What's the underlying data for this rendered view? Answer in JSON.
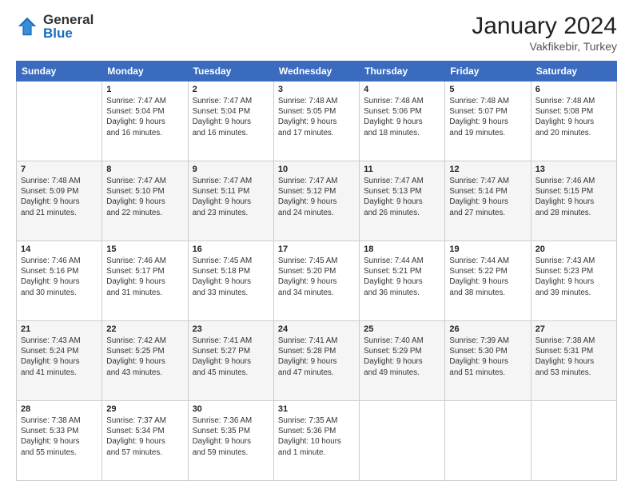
{
  "header": {
    "logo_general": "General",
    "logo_blue": "Blue",
    "cal_title": "January 2024",
    "cal_subtitle": "Vakfikebir, Turkey"
  },
  "days_of_week": [
    "Sunday",
    "Monday",
    "Tuesday",
    "Wednesday",
    "Thursday",
    "Friday",
    "Saturday"
  ],
  "weeks": [
    [
      {
        "num": "",
        "info": ""
      },
      {
        "num": "1",
        "info": "Sunrise: 7:47 AM\nSunset: 5:04 PM\nDaylight: 9 hours\nand 16 minutes."
      },
      {
        "num": "2",
        "info": "Sunrise: 7:47 AM\nSunset: 5:04 PM\nDaylight: 9 hours\nand 16 minutes."
      },
      {
        "num": "3",
        "info": "Sunrise: 7:48 AM\nSunset: 5:05 PM\nDaylight: 9 hours\nand 17 minutes."
      },
      {
        "num": "4",
        "info": "Sunrise: 7:48 AM\nSunset: 5:06 PM\nDaylight: 9 hours\nand 18 minutes."
      },
      {
        "num": "5",
        "info": "Sunrise: 7:48 AM\nSunset: 5:07 PM\nDaylight: 9 hours\nand 19 minutes."
      },
      {
        "num": "6",
        "info": "Sunrise: 7:48 AM\nSunset: 5:08 PM\nDaylight: 9 hours\nand 20 minutes."
      }
    ],
    [
      {
        "num": "7",
        "info": "Sunrise: 7:48 AM\nSunset: 5:09 PM\nDaylight: 9 hours\nand 21 minutes."
      },
      {
        "num": "8",
        "info": "Sunrise: 7:47 AM\nSunset: 5:10 PM\nDaylight: 9 hours\nand 22 minutes."
      },
      {
        "num": "9",
        "info": "Sunrise: 7:47 AM\nSunset: 5:11 PM\nDaylight: 9 hours\nand 23 minutes."
      },
      {
        "num": "10",
        "info": "Sunrise: 7:47 AM\nSunset: 5:12 PM\nDaylight: 9 hours\nand 24 minutes."
      },
      {
        "num": "11",
        "info": "Sunrise: 7:47 AM\nSunset: 5:13 PM\nDaylight: 9 hours\nand 26 minutes."
      },
      {
        "num": "12",
        "info": "Sunrise: 7:47 AM\nSunset: 5:14 PM\nDaylight: 9 hours\nand 27 minutes."
      },
      {
        "num": "13",
        "info": "Sunrise: 7:46 AM\nSunset: 5:15 PM\nDaylight: 9 hours\nand 28 minutes."
      }
    ],
    [
      {
        "num": "14",
        "info": "Sunrise: 7:46 AM\nSunset: 5:16 PM\nDaylight: 9 hours\nand 30 minutes."
      },
      {
        "num": "15",
        "info": "Sunrise: 7:46 AM\nSunset: 5:17 PM\nDaylight: 9 hours\nand 31 minutes."
      },
      {
        "num": "16",
        "info": "Sunrise: 7:45 AM\nSunset: 5:18 PM\nDaylight: 9 hours\nand 33 minutes."
      },
      {
        "num": "17",
        "info": "Sunrise: 7:45 AM\nSunset: 5:20 PM\nDaylight: 9 hours\nand 34 minutes."
      },
      {
        "num": "18",
        "info": "Sunrise: 7:44 AM\nSunset: 5:21 PM\nDaylight: 9 hours\nand 36 minutes."
      },
      {
        "num": "19",
        "info": "Sunrise: 7:44 AM\nSunset: 5:22 PM\nDaylight: 9 hours\nand 38 minutes."
      },
      {
        "num": "20",
        "info": "Sunrise: 7:43 AM\nSunset: 5:23 PM\nDaylight: 9 hours\nand 39 minutes."
      }
    ],
    [
      {
        "num": "21",
        "info": "Sunrise: 7:43 AM\nSunset: 5:24 PM\nDaylight: 9 hours\nand 41 minutes."
      },
      {
        "num": "22",
        "info": "Sunrise: 7:42 AM\nSunset: 5:25 PM\nDaylight: 9 hours\nand 43 minutes."
      },
      {
        "num": "23",
        "info": "Sunrise: 7:41 AM\nSunset: 5:27 PM\nDaylight: 9 hours\nand 45 minutes."
      },
      {
        "num": "24",
        "info": "Sunrise: 7:41 AM\nSunset: 5:28 PM\nDaylight: 9 hours\nand 47 minutes."
      },
      {
        "num": "25",
        "info": "Sunrise: 7:40 AM\nSunset: 5:29 PM\nDaylight: 9 hours\nand 49 minutes."
      },
      {
        "num": "26",
        "info": "Sunrise: 7:39 AM\nSunset: 5:30 PM\nDaylight: 9 hours\nand 51 minutes."
      },
      {
        "num": "27",
        "info": "Sunrise: 7:38 AM\nSunset: 5:31 PM\nDaylight: 9 hours\nand 53 minutes."
      }
    ],
    [
      {
        "num": "28",
        "info": "Sunrise: 7:38 AM\nSunset: 5:33 PM\nDaylight: 9 hours\nand 55 minutes."
      },
      {
        "num": "29",
        "info": "Sunrise: 7:37 AM\nSunset: 5:34 PM\nDaylight: 9 hours\nand 57 minutes."
      },
      {
        "num": "30",
        "info": "Sunrise: 7:36 AM\nSunset: 5:35 PM\nDaylight: 9 hours\nand 59 minutes."
      },
      {
        "num": "31",
        "info": "Sunrise: 7:35 AM\nSunset: 5:36 PM\nDaylight: 10 hours\nand 1 minute."
      },
      {
        "num": "",
        "info": ""
      },
      {
        "num": "",
        "info": ""
      },
      {
        "num": "",
        "info": ""
      }
    ]
  ]
}
